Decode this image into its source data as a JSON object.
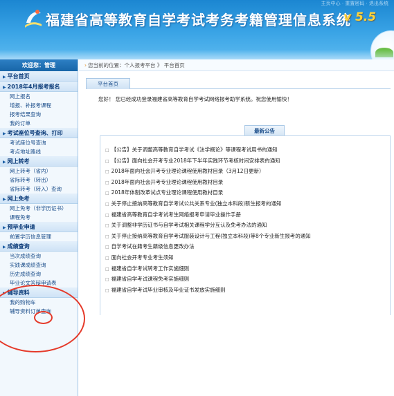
{
  "header": {
    "title": "福建省高等教育自学考试考务考籍管理信息系统",
    "version": "v 5.5",
    "top_text": "主页中心 · 重置密码 · 退出系统"
  },
  "sidebar": {
    "welcome": "欢迎您：管理",
    "sections": [
      {
        "label": "平台首页",
        "items": []
      },
      {
        "label": "2018年4月报考报名",
        "items": [
          "网上报名",
          "增报、补报考课程",
          "报考结果查询",
          "我的订单"
        ]
      },
      {
        "label": "考试座位号查询、打印",
        "items": [
          "考试座位号查询",
          "考点地址路线"
        ]
      },
      {
        "label": "网上转考",
        "items": [
          "网上转考（省内）",
          "省际转考（转出）",
          "省际转考（转入）查询"
        ]
      },
      {
        "label": "网上免考",
        "items": [
          "网上免考（非学历证书）",
          "课程免考"
        ]
      },
      {
        "label": "预毕业申请",
        "items": [
          "前置学历信息管理"
        ]
      },
      {
        "label": "成绩查询",
        "items": [
          "当次成绩查询",
          "实践课成绩查询",
          "历史成绩查询",
          "毕业论文答辩申请表"
        ]
      },
      {
        "label": "辅导资料",
        "items": [
          "我的购物车",
          "辅导资料订单查询"
        ]
      }
    ]
  },
  "main": {
    "breadcrumb": "您当前的位置：个人报考平台 》 平台首页",
    "tab_label": "平台首页",
    "welcome_text": "您好！ 您已经成功登录福建省高等教育自学考试网络报考助学系统。祝您使用愉快！",
    "notice_title": "最新公告",
    "notices": [
      "【公告】关于调整高等教育自学考试《法学概论》等课程考试用书的通知",
      "【公告】面向社会开考专业2018年下半年实践环节考核时间安排表的通知",
      "2018年面向社会开考专业理论课程使用教材目录（3月12日更新）",
      "2018年面向社会开考专业理论课程使用教材目录",
      "2018年体制改革试点专业理论课程使用教材目录",
      "关于停止接纳高等教育自学考试公共关系专业(独立本科段)新生报考的通知",
      "福建省高等教育自学考试考生网络报考申请毕业操作手册",
      "关于调整非学历证书与自学考试相关课程学分互认及免考办法的通知",
      "关于停止接纳高等教育自学考试服装设计与工程(独立本科段)等8个专业新生报考的通知",
      "自学考试在籍考生籍级信息更改办法",
      "面向社会开考专业考生须知",
      "福建省自学考试转考工作实施细则",
      "福建省自学考试课程免考实施细则",
      "福建省自学考试毕业审核及毕业证书发放实施细则"
    ]
  },
  "colors": {
    "header_blue": "#2594dc",
    "version_yellow": "#ffd43a",
    "annotation_red": "#e53a2a",
    "link_blue": "#1a4d8a"
  }
}
